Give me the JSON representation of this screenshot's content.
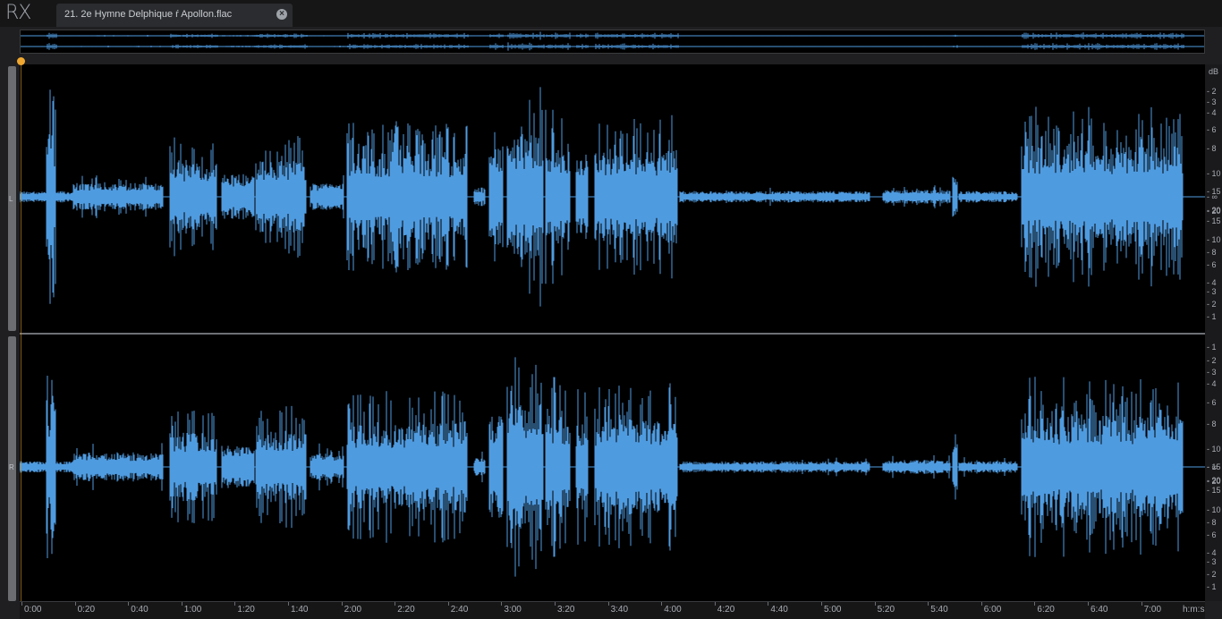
{
  "app": {
    "logo": "RX"
  },
  "tab": {
    "title": "21. 2e Hymne Delphique ŕ Apollon.flac",
    "close_icon": "close-icon"
  },
  "channels": {
    "left": "L",
    "right": "R"
  },
  "waveform_color": "#4f9be0",
  "playhead_color": "#f0a830",
  "db_scale": {
    "unit": "dB",
    "top_ticks": [
      "-2",
      "-3",
      "-4",
      "-6",
      "-8",
      "-10",
      "-15",
      "-20",
      "-∞",
      "-20",
      "-15",
      "-10",
      "-8",
      "-6",
      "-4",
      "-3",
      "-2",
      "-1"
    ],
    "bottom_ticks": [
      "-1",
      "-2",
      "-3",
      "-4",
      "-6",
      "-8",
      "-10",
      "-15",
      "-20",
      "-∞",
      "-20",
      "-15",
      "-10",
      "-8",
      "-6",
      "-4",
      "-3",
      "-2",
      "-1"
    ]
  },
  "timeline": {
    "labels": [
      "0:00",
      "0:20",
      "0:40",
      "1:00",
      "1:20",
      "1:40",
      "2:00",
      "2:20",
      "2:40",
      "3:00",
      "3:20",
      "3:40",
      "4:00",
      "4:20",
      "4:40",
      "5:00",
      "5:20",
      "5:40",
      "6:00",
      "6:20",
      "6:40",
      "7:00"
    ],
    "unit_label": "h:m:s"
  }
}
